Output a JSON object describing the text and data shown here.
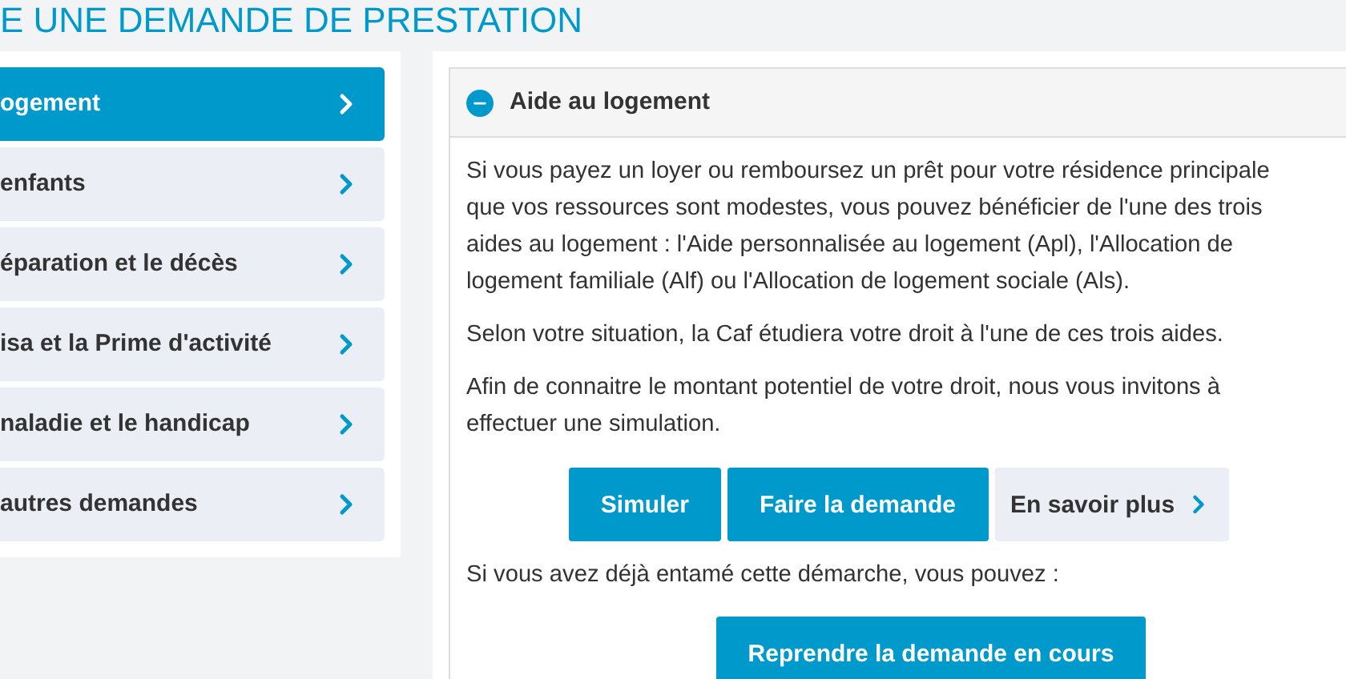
{
  "page_title": "E UNE DEMANDE DE PRESTATION",
  "sidebar": {
    "items": [
      {
        "label": "ogement",
        "selected": true
      },
      {
        "label": "enfants",
        "selected": false
      },
      {
        "label": "éparation et le décès",
        "selected": false
      },
      {
        "label": "isa et la Prime d'activité",
        "selected": false
      },
      {
        "label": "naladie et le handicap",
        "selected": false
      },
      {
        "label": "autres demandes",
        "selected": false
      }
    ]
  },
  "accordion": {
    "title": "Aide au logement",
    "expanded": true,
    "paragraphs": [
      "Si vous payez un loyer ou remboursez un prêt pour votre résidence principale",
      "que vos ressources sont modestes, vous pouvez bénéficier de l'une des trois",
      "aides au logement : l'Aide personnalisée au logement (Apl), l'Allocation de",
      "logement familiale (Alf) ou l'Allocation de logement sociale (Als)."
    ],
    "paragraph_2": "Selon votre situation, la Caf étudiera votre droit à l'une de ces trois aides.",
    "paragraph_3": "Afin de connaitre le montant potentiel de votre droit, nous vous invitons à effectuer une simulation.",
    "buttons": [
      {
        "label": "Simuler",
        "kind": "primary"
      },
      {
        "label": "Faire la demande",
        "kind": "primary"
      },
      {
        "label": "En savoir plus",
        "kind": "secondary"
      }
    ],
    "note": "Si vous avez déjà entamé cette démarche, vous pouvez :",
    "resume_button": "Reprendre la demande en cours"
  }
}
